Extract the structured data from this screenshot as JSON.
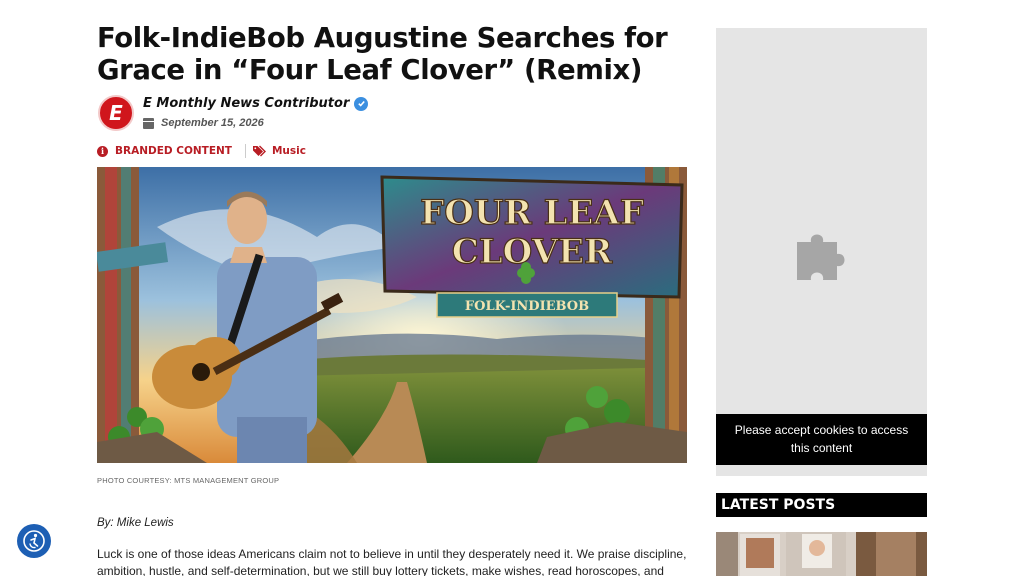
{
  "article": {
    "title": "Folk-IndieBob Augustine Searches for Grace in “Four Leaf Clover” (Remix)",
    "author": {
      "avatar_letter": "E",
      "name": "E Monthly News Contributor",
      "date": "September 15, 2026"
    },
    "tags": {
      "branded": "BRANDED CONTENT",
      "category": "Music"
    },
    "hero_image": {
      "sign_title_line1": "FOUR LEAF",
      "sign_title_line2": "CLOVER",
      "sign_subtitle": "FOLK-INDIEBOB"
    },
    "photo_caption": "PHOTO COURTESY: MTS MANAGEMENT GROUP",
    "byline": "By: Mike Lewis",
    "body_intro": "Luck is one of those ideas Americans claim not to believe in until they desperately need it. We praise discipline, ambition, hustle, and self-determination, but we still buy lottery tickets, make wishes, read horoscopes, and search"
  },
  "sidebar": {
    "cookie_notice": "Please accept cookies to access this content",
    "latest_posts_heading": "LATEST POSTS"
  },
  "icons": {
    "verified": "verified-badge-icon",
    "calendar": "calendar-icon",
    "info": "info-icon",
    "tags": "tags-icon",
    "puzzle": "puzzle-icon",
    "accessibility": "accessibility-icon"
  },
  "colors": {
    "brand_red": "#b81d24",
    "verified_blue": "#3b8fe0",
    "accessibility_blue": "#1d5fb4"
  }
}
